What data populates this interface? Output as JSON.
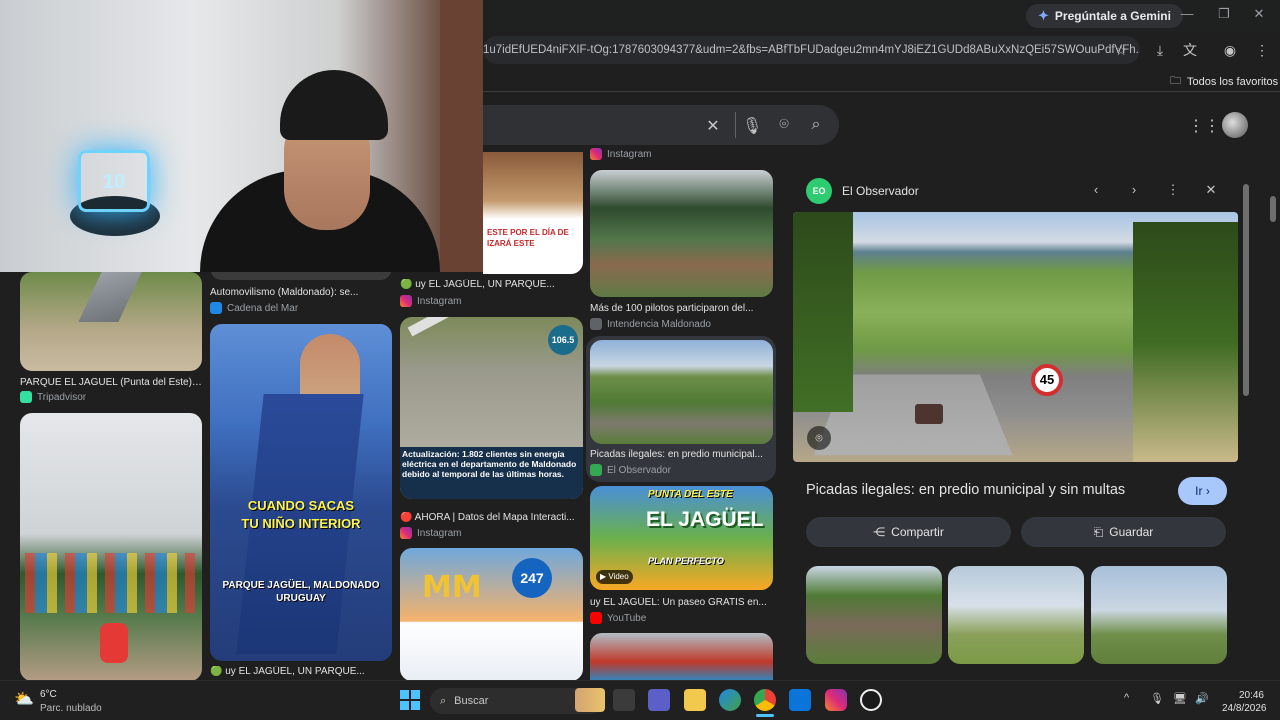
{
  "browser": {
    "gemini_label": "Pregúntale a Gemini",
    "url": "1u7idEfUED4niFXIF-tOg:1787603094377&udm=2&fbs=ABfTbFUDadgeu2mn4mYJ8iEZ1GUDd8ABuXxNzQEi57SWOuuPdfVFh...",
    "bookmarks_folder": "Todos los favoritos"
  },
  "grid": {
    "col1": [
      {
        "caption": "PARQUE EL JAGUEL (Punta del Este) ...",
        "source": "Tripadvisor",
        "color": "#34e0a1"
      }
    ],
    "col2": [
      {
        "caption": "Automovilismo (Maldonado): se...",
        "source": "Cadena del Mar",
        "color": "#1e88e5"
      },
      {
        "caption": "🟢 uy EL JAGÜEL, UN PARQUE...",
        "source": "",
        "color": "#c13584",
        "overlay1": "CUANDO SACAS",
        "overlay2": "TU NIÑO INTERIOR",
        "overlay3": "PARQUE JAGÜEL, MALDONADO",
        "overlay4": "URUGUAY"
      }
    ],
    "col3": [
      {
        "caption": "🟢 uy EL JAGÜEL, UN PARQUE...",
        "source": "Instagram",
        "color": "#c13584"
      },
      {
        "caption": "Actualización: 1.802 clientes sin energía eléctrica en el departamento de Maldonado debido al temporal de las últimas horas.",
        "badge": "106.5"
      },
      {
        "caption": "🔴 AHORA | Datos del Mapa Interacti...",
        "source": "Instagram",
        "color": "#c13584",
        "badge_num": "247"
      }
    ],
    "col4": [
      {
        "top_source": "Instagram"
      },
      {
        "caption": "Más de 100 pilotos participaron del...",
        "source": "Intendencia Maldonado",
        "color": "#5f6368"
      },
      {
        "caption": "Picadas ilegales: en predio municipal...",
        "source": "El Observador",
        "color": "#34a853"
      },
      {
        "caption": "uy EL JAGÜEL: Un paseo GRATIS en...",
        "source": "YouTube",
        "color": "#ff0000",
        "video": "Video",
        "title_overlay": "EL JAGÜEL",
        "top_overlay": "PUNTA DEL ESTE",
        "sub_overlay": "PLAN PERFECTO"
      }
    ],
    "col2_top_text": "ESTE POR EL DÍA DE",
    "col2_top_text2": "IZARÁ ESTE"
  },
  "panel": {
    "source": "El Observador",
    "source_initials": "EO",
    "heading": "Picadas ilegales: en predio municipal y sin multas",
    "go_label": "Ir",
    "share_label": "Compartir",
    "save_label": "Guardar",
    "speed_sign": "45"
  },
  "taskbar": {
    "weather_temp": "6°C",
    "weather_desc": "Parc. nublado",
    "search_label": "Buscar",
    "time": "20:46",
    "date": "24/8/2026"
  }
}
